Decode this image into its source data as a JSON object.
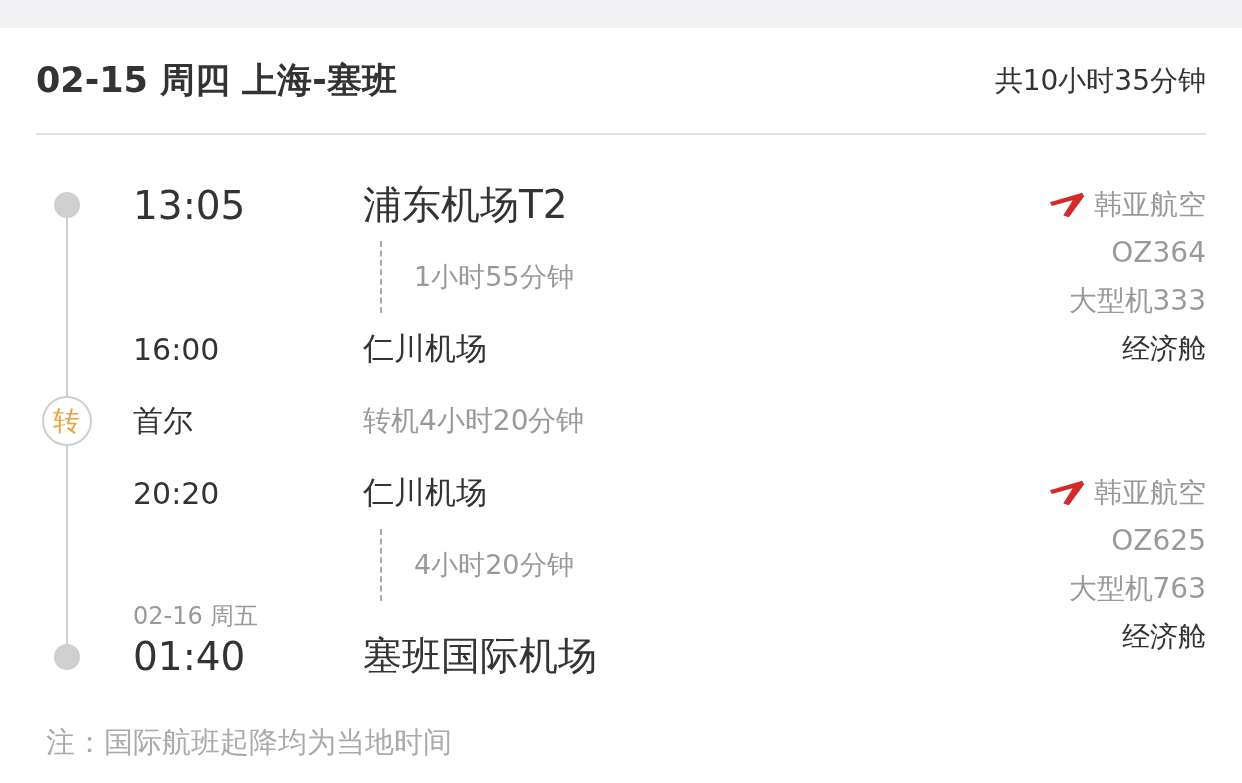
{
  "header": {
    "title": "02-15 周四 上海-塞班",
    "total": "共10小时35分钟"
  },
  "segments": [
    {
      "dep_time": "13:05",
      "dep_airport": "浦东机场T2",
      "duration": "1小时55分钟",
      "arr_time": "16:00",
      "arr_airport": "仁川机场",
      "airline": "韩亚航空",
      "flight": "OZ364",
      "aircraft": "大型机333",
      "cabin": "经济舱"
    },
    {
      "dep_time": "20:20",
      "dep_airport": "仁川机场",
      "duration": "4小时20分钟",
      "arr_date": "02-16 周五",
      "arr_time": "01:40",
      "arr_airport": "塞班国际机场",
      "airline": "韩亚航空",
      "flight": "OZ625",
      "aircraft": "大型机763",
      "cabin": "经济舱"
    }
  ],
  "transfer": {
    "badge": "转",
    "city": "首尔",
    "text": "转机4小时20分钟"
  },
  "note": "注：国际航班起降均为当地时间"
}
